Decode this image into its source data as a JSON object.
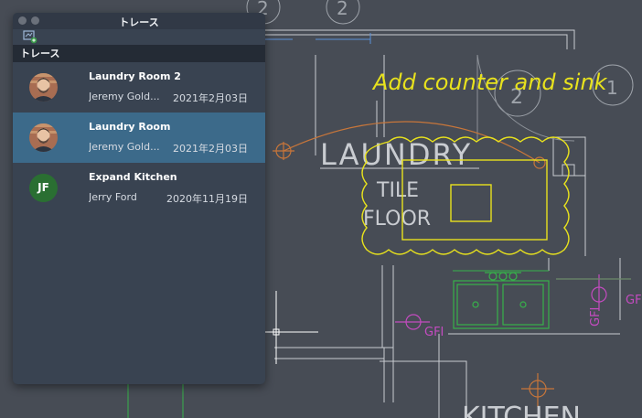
{
  "palette": {
    "title": "トレース",
    "section_header": "トレース",
    "items": [
      {
        "title": "Laundry Room 2",
        "author": "Jeremy Gold...",
        "date": "2021年2月03日",
        "avatar": "photo",
        "selected": false
      },
      {
        "title": "Laundry Room",
        "author": "Jeremy Gold...",
        "date": "2021年2月03日",
        "avatar": "photo",
        "selected": true
      },
      {
        "title": "Expand Kitchen",
        "author": "Jerry Ford",
        "date": "2020年11月19日",
        "avatar": "initials",
        "initials": "JF",
        "selected": false
      }
    ]
  },
  "drawing": {
    "markup_note": "Add counter and sink",
    "room_label": "LAUNDRY",
    "floor_label_1": "TILE",
    "floor_label_2": "FLOOR",
    "door_tag_1": "2",
    "door_tag_2": "1",
    "top_tag_1": "2",
    "top_tag_2": "2",
    "gfi_1": "GFI",
    "gfi_2": "GFI",
    "gfi_3": "GFI",
    "kitchen_label": "KITCHEN"
  },
  "colors": {
    "background": "#474c55",
    "palette_bg": "#394351",
    "selected_row": "#3c6a8a",
    "markup_yellow": "#e8e21d",
    "fixture_green": "#37b24a",
    "electrical_magenta": "#c44bc0",
    "door_orange": "#c8763a"
  }
}
